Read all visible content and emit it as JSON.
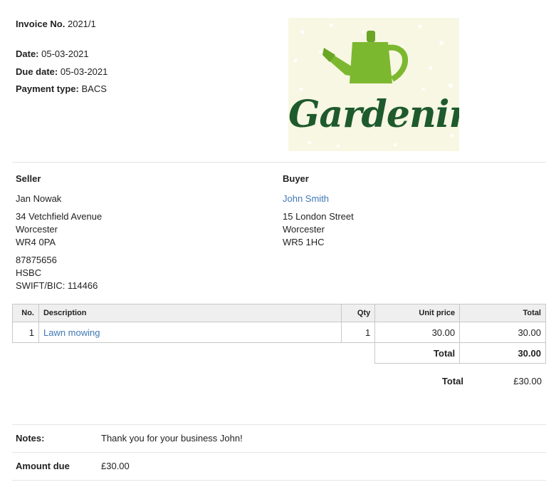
{
  "invoice": {
    "number_label": "Invoice No.",
    "number": "2021/1",
    "date_label": "Date:",
    "date": "05-03-2021",
    "due_label": "Due date:",
    "due": "05-03-2021",
    "payment_label": "Payment type:",
    "payment": "BACS"
  },
  "logo": {
    "text": "Gardening",
    "icon": "watering-can-icon"
  },
  "seller": {
    "heading": "Seller",
    "name": "Jan Nowak",
    "address": [
      "34 Vetchfield Avenue",
      "Worcester",
      "WR4 0PA"
    ],
    "bank": [
      "87875656",
      "HSBC",
      "SWIFT/BIC: 114466"
    ]
  },
  "buyer": {
    "heading": "Buyer",
    "name": "John Smith",
    "address": [
      "15 London Street",
      "Worcester",
      "WR5 1HC"
    ]
  },
  "table": {
    "headers": [
      "No.",
      "Description",
      "Qty",
      "Unit price",
      "Total"
    ],
    "rows": [
      {
        "no": "1",
        "description": "Lawn mowing",
        "qty": "1",
        "unit_price": "30.00",
        "total": "30.00"
      }
    ],
    "subtotal_label": "Total",
    "subtotal": "30.00"
  },
  "grand_total": {
    "label": "Total",
    "value": "£30.00"
  },
  "notes": {
    "label": "Notes:",
    "text": "Thank you for your business John!"
  },
  "amount_due": {
    "label": "Amount due",
    "value": "£30.00"
  },
  "colors": {
    "link": "#3f78b5",
    "logo_bg": "#f7f7e3",
    "can_green": "#7cb82f",
    "text_green": "#1e5a2c"
  }
}
